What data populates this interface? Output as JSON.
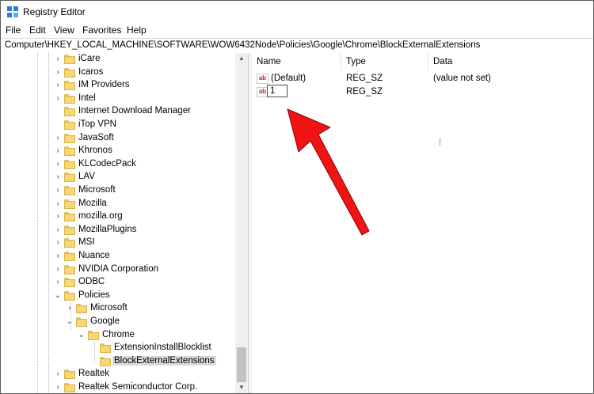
{
  "window": {
    "title": "Registry Editor"
  },
  "menu": [
    "File",
    "Edit",
    "View",
    "Favorites",
    "Help"
  ],
  "address": "Computer\\HKEY_LOCAL_MACHINE\\SOFTWARE\\WOW6432Node\\Policies\\Google\\Chrome\\BlockExternalExtensions",
  "tree": {
    "nodes": [
      {
        "label": "iCare",
        "expander": "›"
      },
      {
        "label": "Icaros",
        "expander": "›"
      },
      {
        "label": "IM Providers",
        "expander": "›"
      },
      {
        "label": "Intel",
        "expander": "›"
      },
      {
        "label": "Internet Download Manager",
        "expander": ""
      },
      {
        "label": "iTop VPN",
        "expander": ""
      },
      {
        "label": "JavaSoft",
        "expander": "›"
      },
      {
        "label": "Khronos",
        "expander": "›"
      },
      {
        "label": "KLCodecPack",
        "expander": "›"
      },
      {
        "label": "LAV",
        "expander": "›"
      },
      {
        "label": "Microsoft",
        "expander": "›"
      },
      {
        "label": "Mozilla",
        "expander": "›"
      },
      {
        "label": "mozilla.org",
        "expander": "›"
      },
      {
        "label": "MozillaPlugins",
        "expander": "›"
      },
      {
        "label": "MSI",
        "expander": "›"
      },
      {
        "label": "Nuance",
        "expander": "›"
      },
      {
        "label": "NVIDIA Corporation",
        "expander": "›"
      },
      {
        "label": "ODBC",
        "expander": "›"
      },
      {
        "label": "Policies",
        "expander": "⌄"
      },
      {
        "label": "Microsoft",
        "expander": "›"
      },
      {
        "label": "Google",
        "expander": "⌄"
      },
      {
        "label": "Chrome",
        "expander": "⌄"
      },
      {
        "label": "ExtensionInstallBlocklist",
        "expander": ""
      },
      {
        "label": "BlockExternalExtensions",
        "expander": ""
      },
      {
        "label": "Realtek",
        "expander": "›"
      },
      {
        "label": "Realtek Semiconductor Corp.",
        "expander": "›"
      }
    ]
  },
  "list": {
    "columns": [
      "Name",
      "Type",
      "Data"
    ],
    "rows": [
      {
        "name": "(Default)",
        "type": "REG_SZ",
        "data": "(value not set)",
        "icon": "string-value-icon"
      },
      {
        "name": "1",
        "type": "REG_SZ",
        "data": "",
        "icon": "string-value-icon",
        "editing": true
      }
    ]
  },
  "icon_text": "ab",
  "colors": {
    "arrow": "#f01414",
    "selection": "#d9d9d9",
    "folder": "#f5d878"
  }
}
